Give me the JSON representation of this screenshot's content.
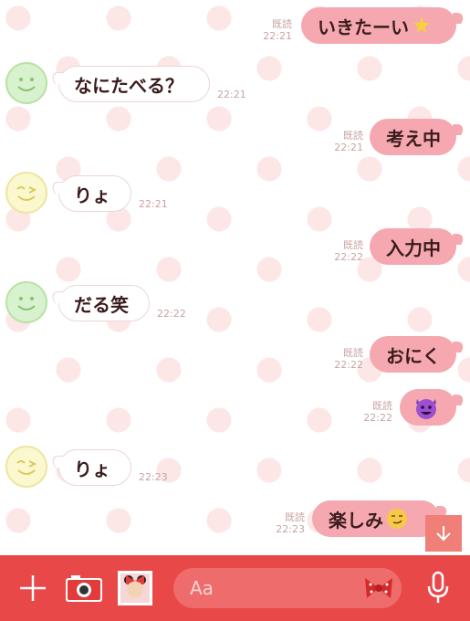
{
  "messages": [
    {
      "side": "out",
      "text": "いきたーい",
      "emoji": "star-emoji",
      "read": "既読",
      "time": "22:21"
    },
    {
      "side": "in",
      "avatar": "green-smile-avatar",
      "text": "なにたべる？",
      "time": "22:21"
    },
    {
      "side": "out",
      "text": "考え中",
      "read": "既読",
      "time": "22:21"
    },
    {
      "side": "in",
      "avatar": "yellow-wink-avatar",
      "text": "りょ",
      "time": "22:21"
    },
    {
      "side": "out",
      "text": "入力中",
      "read": "既読",
      "time": "22:22"
    },
    {
      "side": "in",
      "avatar": "green-smile-avatar",
      "text": "だる笑",
      "time": "22:22"
    },
    {
      "side": "out",
      "text": "おにく",
      "read": "既読",
      "time": "22:22"
    },
    {
      "side": "out",
      "text": "",
      "emoji": "smiling-devil-emoji",
      "read": "既読",
      "time": "22:22"
    },
    {
      "side": "in",
      "avatar": "yellow-wink-avatar",
      "text": "りょ",
      "time": "22:23"
    },
    {
      "side": "out",
      "text": "楽しみ",
      "emoji": "smirk-emoji",
      "read": "既読",
      "time": "22:23"
    }
  ],
  "input": {
    "placeholder": "Aa"
  },
  "icons": {
    "add": "plus-icon",
    "camera": "camera-icon",
    "image": "photo-icon",
    "sticker": "bow-sticker-icon",
    "mic": "microphone-icon",
    "scroll": "arrow-down-icon"
  },
  "colors": {
    "bar": "#e94848",
    "bubble_out": "#f5a8b0",
    "bubble_in": "#ffffff"
  }
}
